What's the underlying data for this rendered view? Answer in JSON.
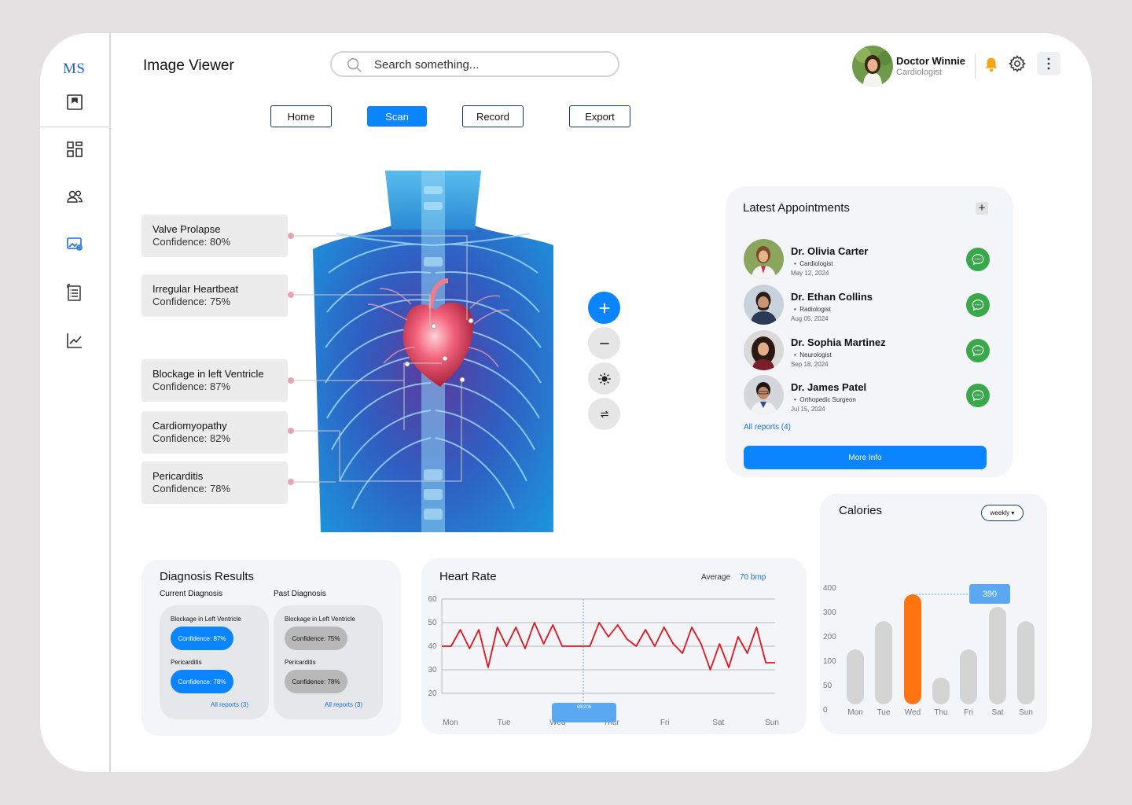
{
  "brand": {
    "logo": "MS"
  },
  "header": {
    "title": "Image Viewer",
    "search_placeholder": "Search something...",
    "user": {
      "name": "Doctor Winnie",
      "role": "Cardiologist"
    }
  },
  "nav": {
    "tabs": [
      {
        "label": "Home",
        "active": false
      },
      {
        "label": "Scan",
        "active": true
      },
      {
        "label": "Record",
        "active": false
      },
      {
        "label": "Export",
        "active": false
      }
    ]
  },
  "sidebar": {
    "items": [
      {
        "icon": "report-icon"
      },
      {
        "icon": "dashboard-icon"
      },
      {
        "icon": "patients-icon"
      },
      {
        "icon": "image-viewer-icon",
        "active": true
      },
      {
        "icon": "records-icon"
      },
      {
        "icon": "analytics-icon"
      }
    ]
  },
  "findings": [
    {
      "title": "Valve Prolapse",
      "confidence": "Confidence: 80%"
    },
    {
      "title": "Irregular Heartbeat",
      "confidence": "Confidence: 75%"
    },
    {
      "title": "Blockage in left Ventricle",
      "confidence": "Confidence: 87%"
    },
    {
      "title": "Cardiomyopathy",
      "confidence": "Confidence: 82%"
    },
    {
      "title": "Pericarditis",
      "confidence": "Confidence: 78%"
    }
  ],
  "tools": [
    {
      "icon": "zoom-in-icon"
    },
    {
      "icon": "zoom-out-icon"
    },
    {
      "icon": "brightness-icon"
    },
    {
      "icon": "rotate-icon"
    }
  ],
  "appointments": {
    "title": "Latest Appointments",
    "doctors": [
      {
        "name": "Dr. Olivia Carter",
        "specialty": "Cardiologist",
        "date": "May 12, 2024"
      },
      {
        "name": "Dr. Ethan Collins",
        "specialty": "Radiologist",
        "date": "Aug 05, 2024"
      },
      {
        "name": "Dr. Sophia Martinez",
        "specialty": "Neurologist",
        "date": "Sep 18, 2024"
      },
      {
        "name": "Dr. James Patel",
        "specialty": "Orthopedic Surgeon",
        "date": "Jul 15, 2024"
      }
    ],
    "all_reports": "All reports (4)",
    "more_info": "More Info"
  },
  "diagnosis": {
    "title": "Diagnosis Results",
    "current": {
      "label": "Current Diagnosis",
      "items": [
        {
          "name": "Blockage in Left Ventricle",
          "confidence": "Confidence: 87%"
        },
        {
          "name": "Pericarditis",
          "confidence": "Confidence: 78%"
        }
      ],
      "all_reports": "All reports (3)"
    },
    "past": {
      "label": "Past Diagnosis",
      "items": [
        {
          "name": "Blockage in Left Ventricle",
          "confidence": "Confidence: 75%"
        },
        {
          "name": "Pericarditis",
          "confidence": "Confidence: 78%"
        }
      ],
      "all_reports": "All reports (3)"
    }
  },
  "heart_rate": {
    "title": "Heart Rate",
    "average_label": "Average",
    "average_value": "70 bmp",
    "tooltip": "69/206"
  },
  "calories": {
    "title": "Calories",
    "period": "weekly",
    "highlight": "390"
  },
  "colors": {
    "primary": "#0a84ff",
    "chart_line": "#e3141b",
    "calorie_highlight": "#ff7410",
    "calorie_bar": "#d4d4d4",
    "chat": "#39a84a"
  },
  "chart_data": [
    {
      "type": "line",
      "title": "Heart Rate",
      "categories": [
        "Mon",
        "Tue",
        "Wed",
        "Thur",
        "Fri",
        "Sat",
        "Sun"
      ],
      "y_ticks": [
        60,
        50,
        40,
        30,
        20
      ],
      "ylim": [
        20,
        60
      ],
      "series": [
        {
          "values": [
            40,
            40,
            47,
            39,
            47,
            31,
            48,
            40,
            48,
            39,
            50,
            41,
            49,
            40,
            40,
            40,
            40,
            50,
            44,
            49,
            43,
            40,
            47,
            40,
            48,
            41,
            37,
            48,
            41,
            30,
            41,
            31,
            44,
            37,
            48,
            33,
            33
          ]
        }
      ],
      "grid": true
    },
    {
      "type": "bar",
      "title": "Calories",
      "categories": [
        "Mon",
        "Tue",
        "Wed",
        "Thu",
        "Fri",
        "Sat",
        "Sun"
      ],
      "y_ticks": [
        400,
        300,
        200,
        100,
        50,
        0
      ],
      "values": [
        195,
        295,
        390,
        95,
        195,
        345,
        295
      ],
      "highlight_index": 2,
      "highlight_label": "390"
    }
  ]
}
